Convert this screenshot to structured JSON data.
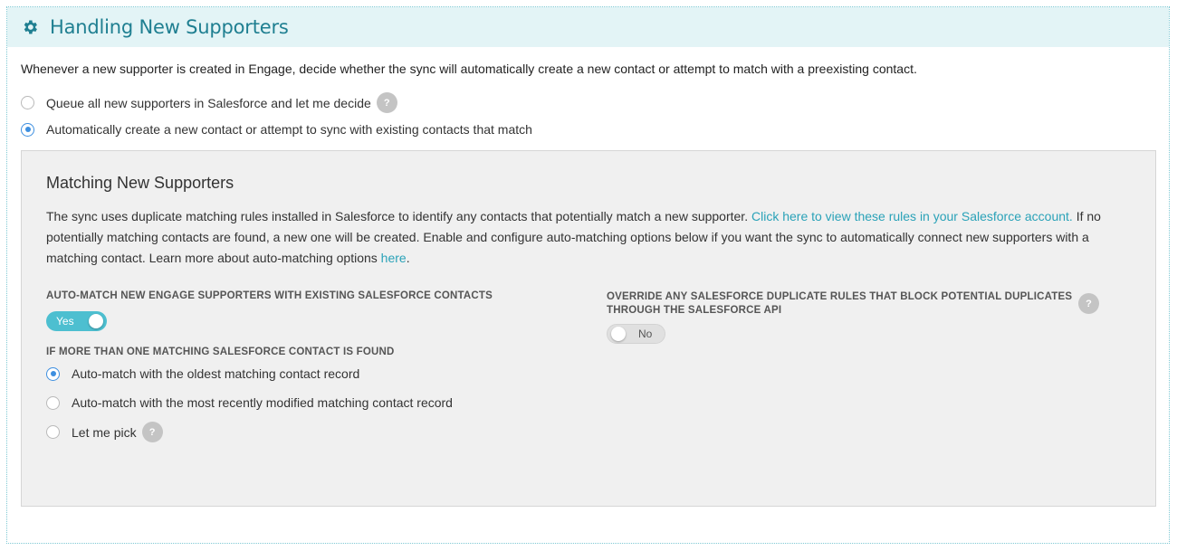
{
  "header": {
    "title": "Handling New Supporters",
    "icon": "gear-icon"
  },
  "intro": "Whenever a new supporter is created in Engage, decide whether the sync will automatically create a new contact or attempt to match with a preexisting contact.",
  "sync_options": [
    {
      "label": "Queue all new supporters in Salesforce and let me decide",
      "checked": false,
      "help": "?"
    },
    {
      "label": "Automatically create a new contact or attempt to sync with existing contacts that match",
      "checked": true
    }
  ],
  "matching": {
    "title": "Matching New Supporters",
    "desc_1": "The sync uses duplicate matching rules installed in Salesforce to identify any contacts that potentially match a new supporter. ",
    "desc_link_rules": "Click here to view these rules in your Salesforce account.",
    "desc_2": " If no potentially matching contacts are found, a new one will be created. Enable and configure auto-matching options below if you want the sync to automatically connect new supporters with a matching contact. Learn more about auto-matching options ",
    "desc_link_here": "here",
    "desc_3": ".",
    "auto_match": {
      "label": "AUTO-MATCH NEW ENGAGE SUPPORTERS WITH EXISTING SALESFORCE CONTACTS",
      "toggle_text": "Yes",
      "on": true
    },
    "multiple_label": "IF MORE THAN ONE MATCHING SALESFORCE CONTACT IS FOUND",
    "multiple_options": [
      {
        "label": "Auto-match with the oldest matching contact record",
        "checked": true
      },
      {
        "label": "Auto-match with the most recently modified matching contact record",
        "checked": false
      },
      {
        "label": "Let me pick",
        "checked": false,
        "help": "?"
      }
    ],
    "override": {
      "label_line1": "OVERRIDE ANY SALESFORCE DUPLICATE RULES THAT BLOCK POTENTIAL DUPLICATES",
      "label_line2": "THROUGH THE SALESFORCE API",
      "help": "?",
      "toggle_text": "No",
      "on": false
    }
  },
  "colors": {
    "accent": "#1f7f91",
    "link": "#2aa2b8",
    "toggle_on": "#4dbfd0",
    "radio": "#3d8fe0",
    "header_bg": "#e3f4f6"
  }
}
